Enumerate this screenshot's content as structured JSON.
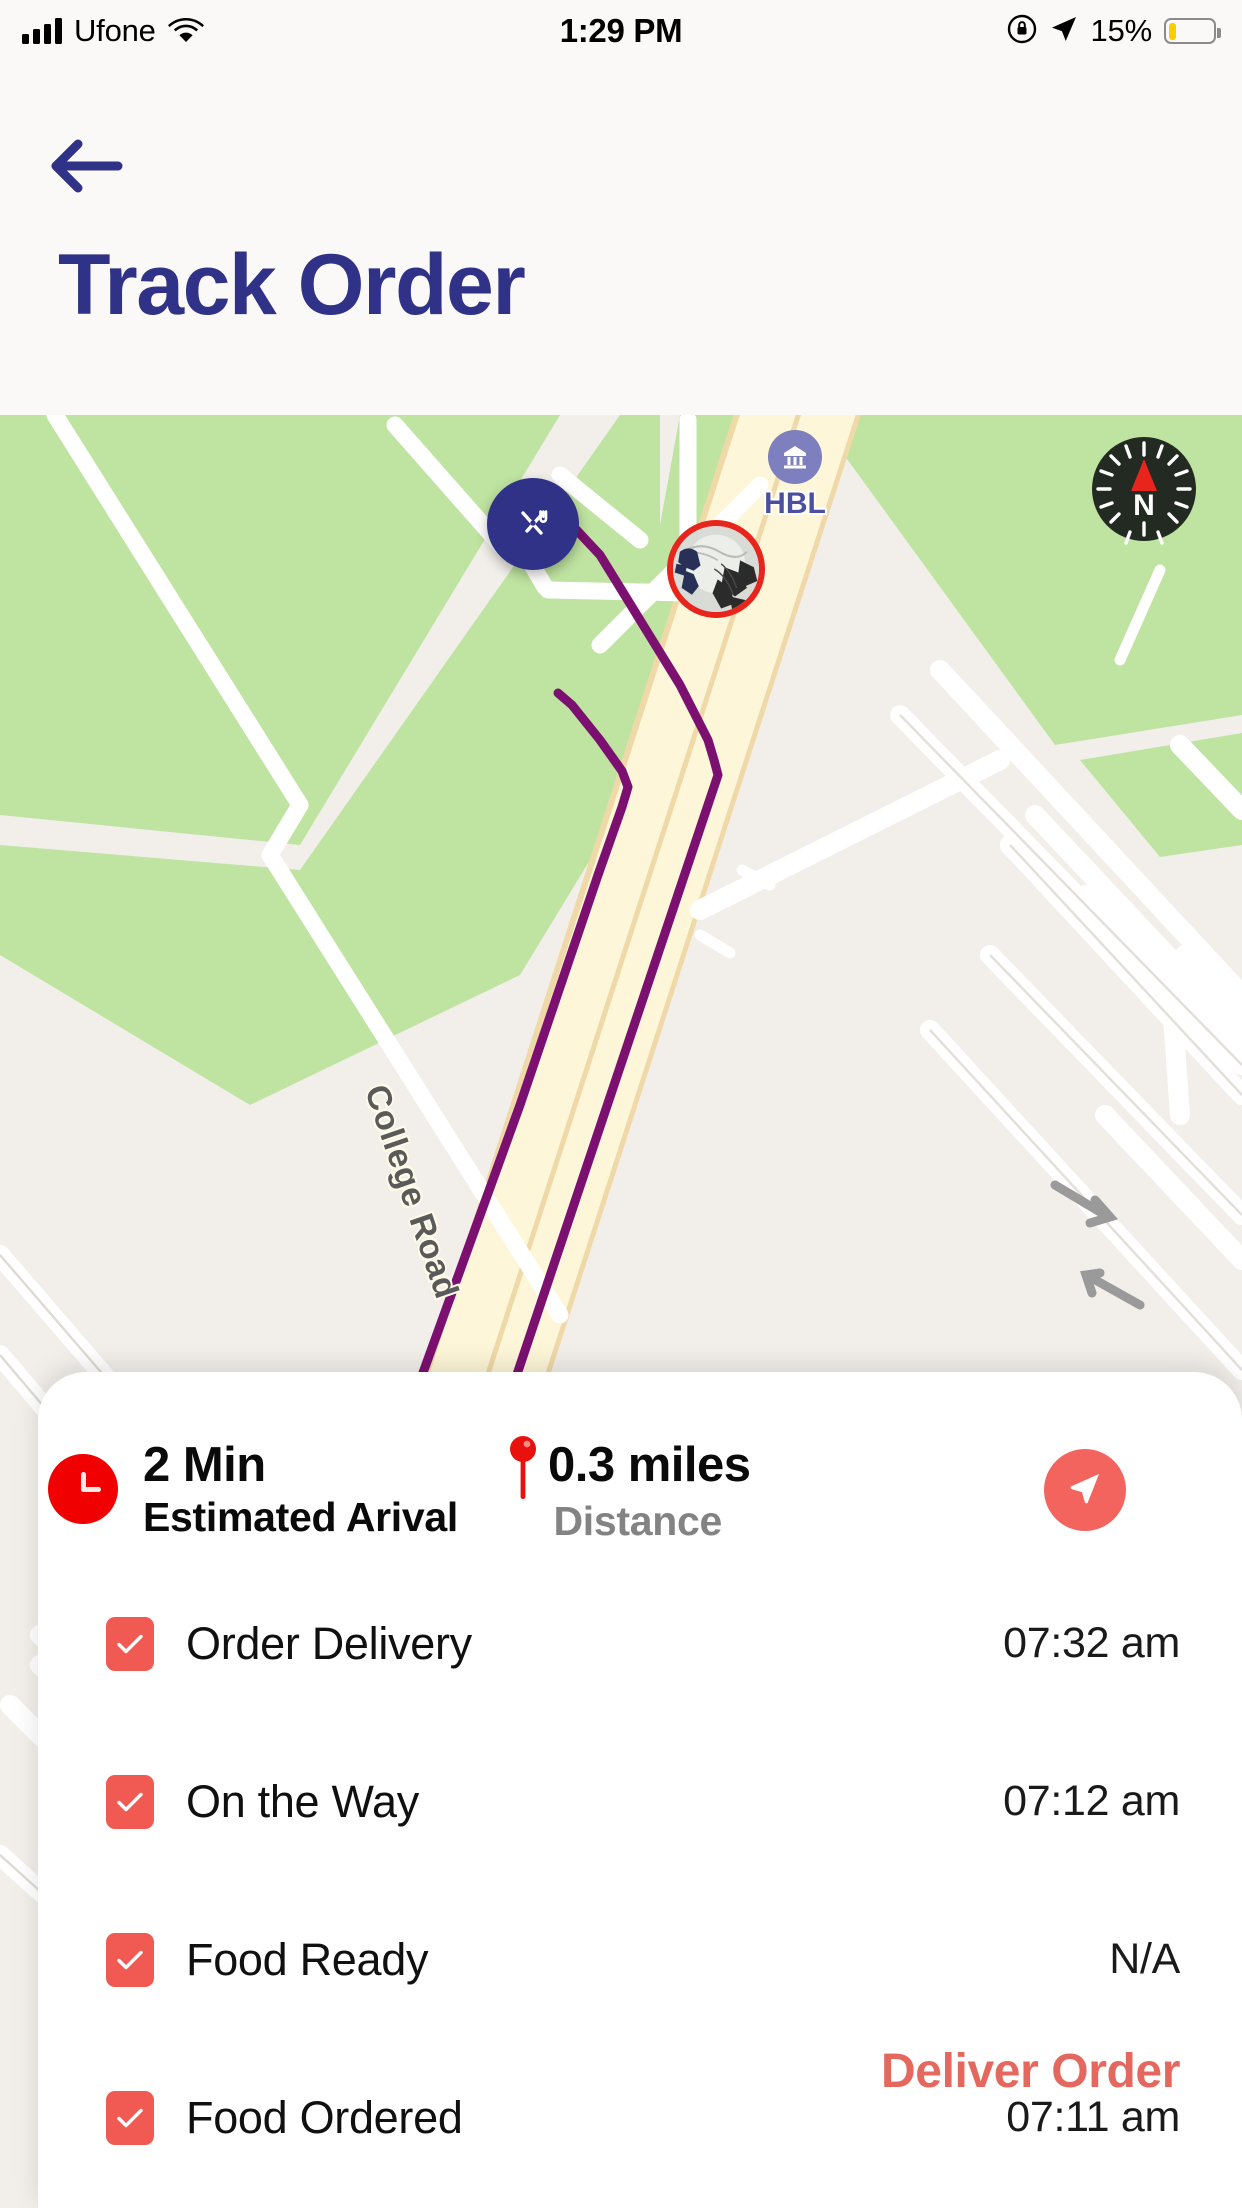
{
  "statusbar": {
    "carrier": "Ufone",
    "time": "1:29 PM",
    "battery_percent": "15%",
    "signal_icon": "cellular-signal-icon",
    "wifi_icon": "wifi-icon",
    "rotation_lock_icon": "rotation-lock-icon",
    "location_icon": "location-arrow-icon",
    "battery_icon": "battery-low-icon"
  },
  "header": {
    "back_icon": "back-arrow-icon",
    "title": "Track Order",
    "title_color": "#2f3286",
    "background": "#faf9f7"
  },
  "map": {
    "road_label": "College Road",
    "poi": {
      "name": "HBL",
      "icon": "bank-icon",
      "marker_color": "#7d7fbe",
      "label_color": "#4c4f9e"
    },
    "restaurant_marker": {
      "icon": "restaurant-utensils-icon",
      "color": "#2f3286"
    },
    "driver_marker": {
      "icon": "driver-avatar",
      "ring_color": "#e8251d"
    },
    "compass": {
      "icon": "compass-icon",
      "north_label": "N",
      "needle_color": "#e8251d",
      "body_color": "#222a22"
    },
    "route_color": "#7b1070",
    "colors": {
      "park": "#bfe3a0",
      "land": "#f2efea",
      "main_road": "#fdf6d8",
      "side_road": "#ffffff"
    }
  },
  "sheet": {
    "eta": {
      "icon": "clock-icon",
      "value": "2 Min",
      "label": "Estimated Arival"
    },
    "distance": {
      "icon": "map-pin-icon",
      "value": "0.3 miles",
      "label": "Distance"
    },
    "navigate_button": {
      "icon": "navigate-arrow-icon",
      "color": "#f4645f"
    },
    "status_steps": [
      {
        "label": "Order Delivery",
        "time": "07:32 am",
        "checked": true
      },
      {
        "label": "On the Way",
        "time": "07:12 am",
        "checked": true
      },
      {
        "label": "Food Ready",
        "time": "N/A",
        "checked": true
      },
      {
        "label": "Food Ordered",
        "time": "07:11 am",
        "checked": true
      }
    ],
    "checkbox_color": "#f05a52",
    "deliver_button": {
      "label": "Deliver Order",
      "color": "#e5685f"
    }
  }
}
